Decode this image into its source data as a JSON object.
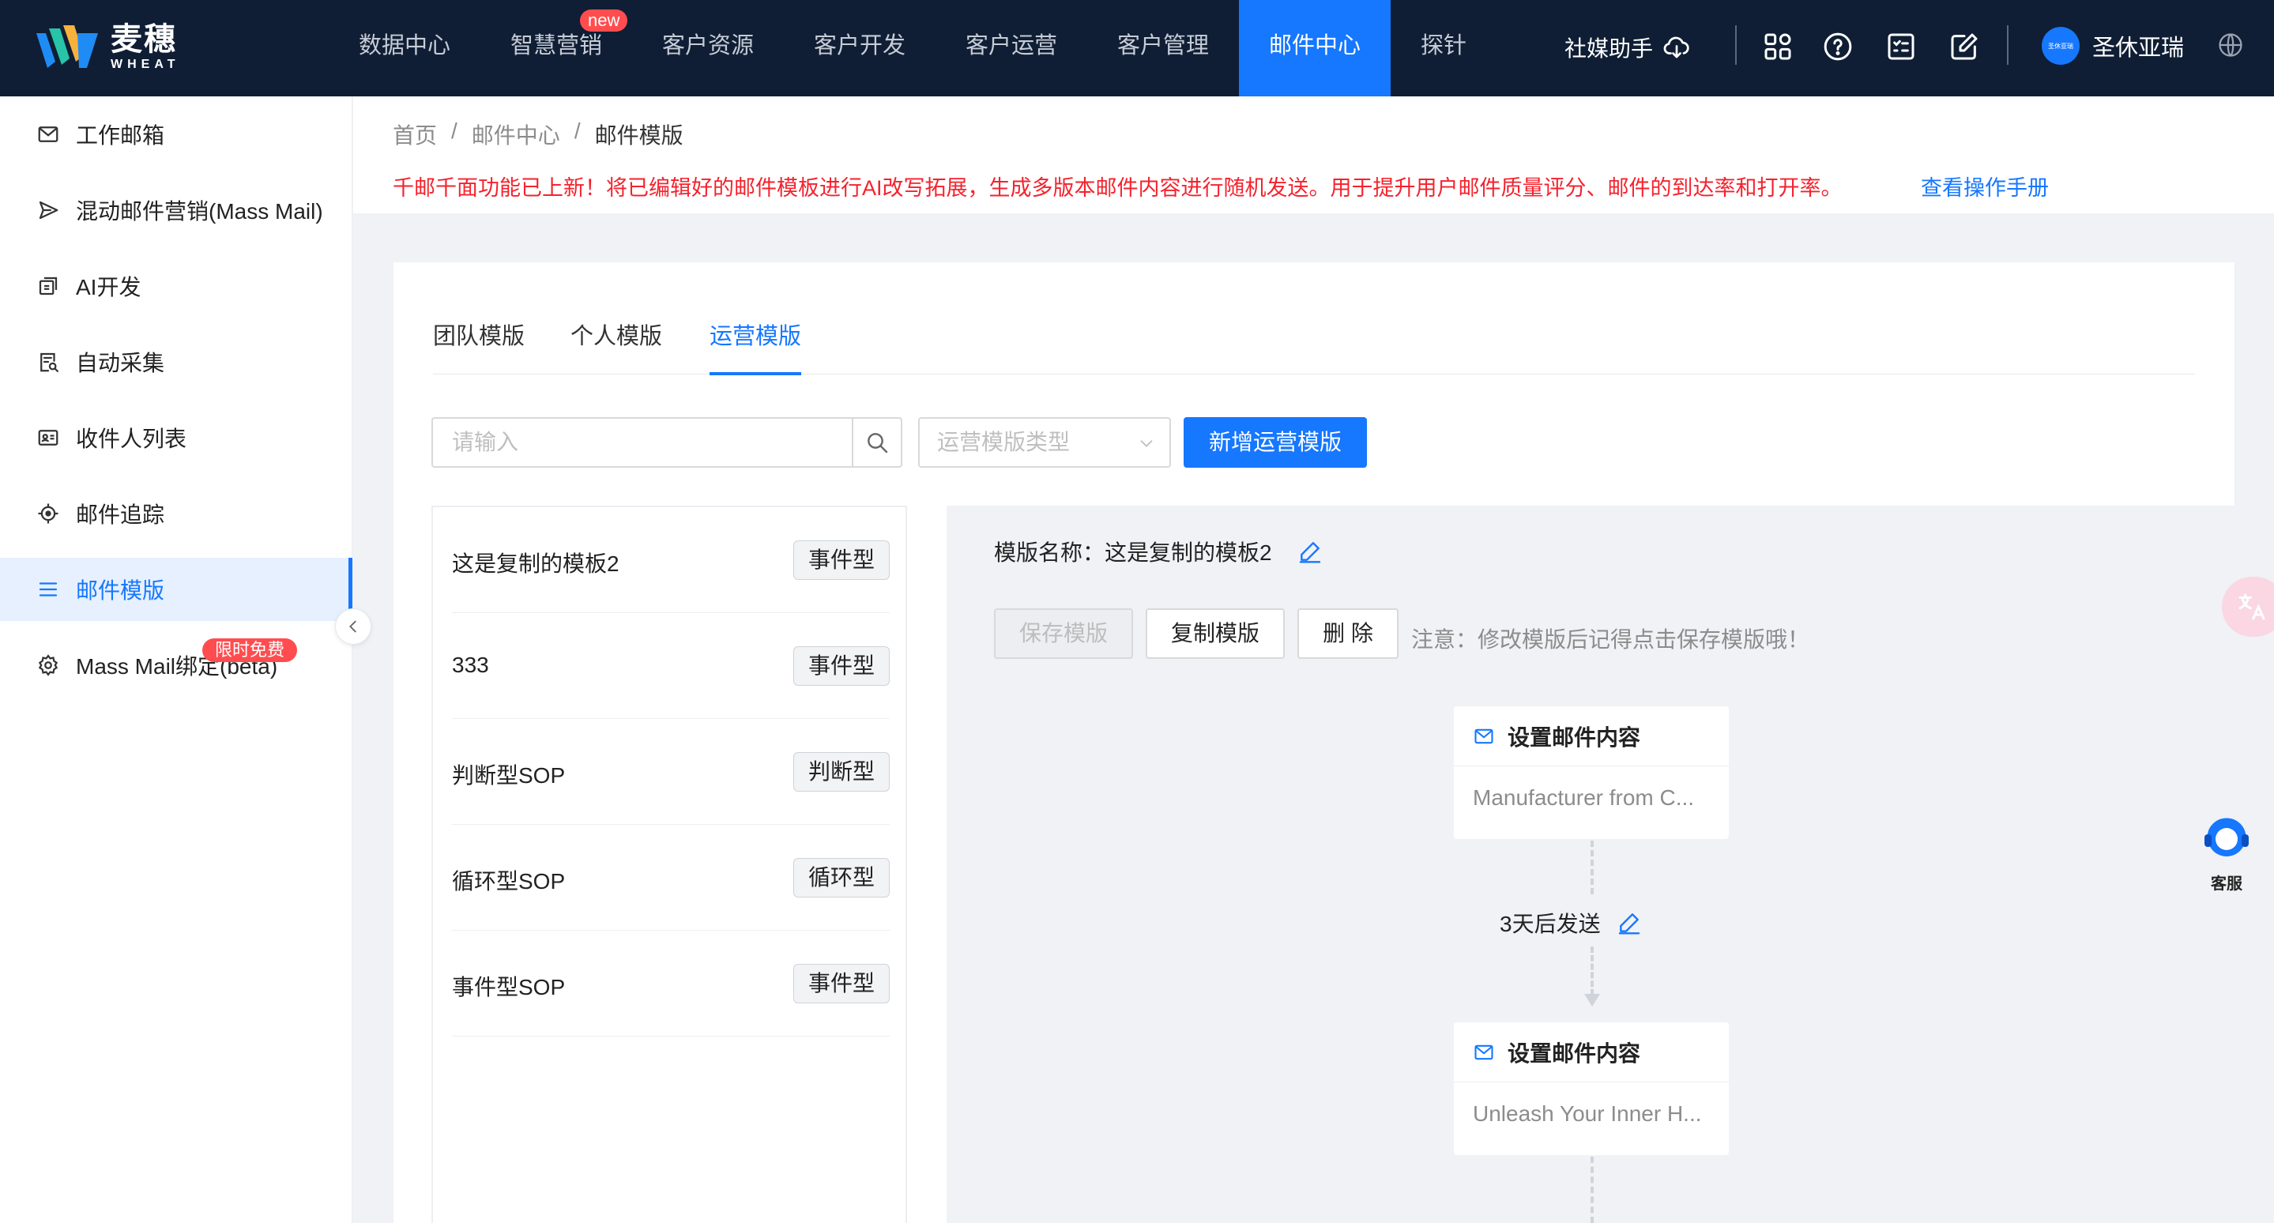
{
  "brand": {
    "name_cn": "麦穗",
    "name_en": "WHEAT"
  },
  "nav": {
    "items": [
      {
        "label": "数据中心"
      },
      {
        "label": "智慧营销",
        "badge": "new"
      },
      {
        "label": "客户资源"
      },
      {
        "label": "客户开发"
      },
      {
        "label": "客户运营"
      },
      {
        "label": "客户管理"
      },
      {
        "label": "邮件中心",
        "active": true
      },
      {
        "label": "探针"
      }
    ],
    "helper_label": "社媒助手",
    "user_name": "圣休亚瑞",
    "avatar_text": "圣休亚瑞"
  },
  "sidebar": {
    "items": [
      {
        "label": "工作邮箱",
        "icon": "mail-icon"
      },
      {
        "label": "混动邮件营销(Mass Mail)",
        "icon": "send-icon"
      },
      {
        "label": "AI开发",
        "icon": "ai-icon"
      },
      {
        "label": "自动采集",
        "icon": "collect-icon"
      },
      {
        "label": "收件人列表",
        "icon": "contacts-icon"
      },
      {
        "label": "邮件追踪",
        "icon": "target-icon"
      },
      {
        "label": "邮件模版",
        "icon": "list-icon",
        "active": true
      },
      {
        "label": "Mass Mail绑定(beta)",
        "icon": "gear-icon",
        "badge": "限时免费"
      }
    ]
  },
  "breadcrumb": {
    "items": [
      "首页",
      "邮件中心",
      "邮件模版"
    ],
    "separator": "/"
  },
  "notice": {
    "text": "千邮千面功能已上新！将已编辑好的邮件模板进行AI改写拓展，生成多版本邮件内容进行随机发送。用于提升用户邮件质量评分、邮件的到达率和打开率。",
    "link": "查看操作手册"
  },
  "tabs": [
    {
      "label": "团队模版"
    },
    {
      "label": "个人模版"
    },
    {
      "label": "运营模版",
      "active": true
    }
  ],
  "filters": {
    "search_placeholder": "请输入",
    "type_placeholder": "运营模版类型",
    "add_button": "新增运营模版"
  },
  "templates": [
    {
      "name": "这是复制的模板2",
      "tag": "事件型"
    },
    {
      "name": "333",
      "tag": "事件型"
    },
    {
      "name": "判断型SOP",
      "tag": "判断型"
    },
    {
      "name": "循环型SOP",
      "tag": "循环型"
    },
    {
      "name": "事件型SOP",
      "tag": "事件型"
    }
  ],
  "editor": {
    "title_label": "模版名称：",
    "title_value": "这是复制的模板2",
    "save_button": "保存模版",
    "copy_button": "复制模版",
    "delete_button": "删 除",
    "hint": "注意：修改模版后记得点击保存模版哦！",
    "flow": [
      {
        "title": "设置邮件内容",
        "preview": "Manufacturer from C..."
      },
      {
        "delay": "3天后发送"
      },
      {
        "title": "设置邮件内容",
        "preview": "Unleash Your Inner H..."
      }
    ]
  },
  "floating": {
    "support_label": "客服"
  },
  "colors": {
    "primary": "#1677ff",
    "topbar": "#0f1e34",
    "danger": "#f5222d",
    "badge": "#ff4d4f"
  }
}
